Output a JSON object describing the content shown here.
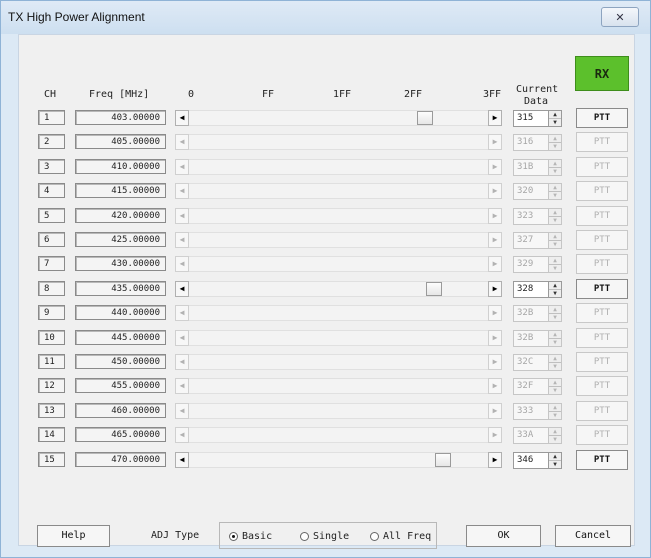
{
  "window": {
    "title": "TX High Power Alignment",
    "close_glyph": "✕"
  },
  "headers": {
    "ch": "CH",
    "freq": "Freq [MHz]",
    "scale": [
      "0",
      "FF",
      "1FF",
      "2FF",
      "3FF"
    ],
    "current_data_line1": "Current",
    "current_data_line2": "Data"
  },
  "rx_button": {
    "label": "RX",
    "color": "#5cc02c"
  },
  "rows": [
    {
      "ch": "1",
      "freq": "403.00000",
      "slider_value": "315",
      "slider_fraction": 0.788,
      "ptt": "PTT",
      "enabled": true
    },
    {
      "ch": "2",
      "freq": "405.00000",
      "slider_value": "316",
      "slider_fraction": 0.771,
      "ptt": "PTT",
      "enabled": false
    },
    {
      "ch": "3",
      "freq": "410.00000",
      "slider_value": "31B",
      "slider_fraction": 0.776,
      "ptt": "PTT",
      "enabled": false
    },
    {
      "ch": "4",
      "freq": "415.00000",
      "slider_value": "320",
      "slider_fraction": 0.781,
      "ptt": "PTT",
      "enabled": false
    },
    {
      "ch": "5",
      "freq": "420.00000",
      "slider_value": "323",
      "slider_fraction": 0.784,
      "ptt": "PTT",
      "enabled": false
    },
    {
      "ch": "6",
      "freq": "425.00000",
      "slider_value": "327",
      "slider_fraction": 0.788,
      "ptt": "PTT",
      "enabled": false
    },
    {
      "ch": "7",
      "freq": "430.00000",
      "slider_value": "329",
      "slider_fraction": 0.79,
      "ptt": "PTT",
      "enabled": false
    },
    {
      "ch": "8",
      "freq": "435.00000",
      "slider_value": "328",
      "slider_fraction": 0.82,
      "ptt": "PTT",
      "enabled": true
    },
    {
      "ch": "9",
      "freq": "440.00000",
      "slider_value": "32B",
      "slider_fraction": 0.793,
      "ptt": "PTT",
      "enabled": false
    },
    {
      "ch": "10",
      "freq": "445.00000",
      "slider_value": "32B",
      "slider_fraction": 0.793,
      "ptt": "PTT",
      "enabled": false
    },
    {
      "ch": "11",
      "freq": "450.00000",
      "slider_value": "32C",
      "slider_fraction": 0.794,
      "ptt": "PTT",
      "enabled": false
    },
    {
      "ch": "12",
      "freq": "455.00000",
      "slider_value": "32F",
      "slider_fraction": 0.797,
      "ptt": "PTT",
      "enabled": false
    },
    {
      "ch": "13",
      "freq": "460.00000",
      "slider_value": "333",
      "slider_fraction": 0.801,
      "ptt": "PTT",
      "enabled": false
    },
    {
      "ch": "14",
      "freq": "465.00000",
      "slider_value": "33A",
      "slider_fraction": 0.808,
      "ptt": "PTT",
      "enabled": false
    },
    {
      "ch": "15",
      "freq": "470.00000",
      "slider_value": "346",
      "slider_fraction": 0.85,
      "ptt": "PTT",
      "enabled": true
    }
  ],
  "footer": {
    "help_label": "Help",
    "adj_type_label": "ADJ Type",
    "adj_options": [
      {
        "label": "Basic",
        "selected": true
      },
      {
        "label": "Single",
        "selected": false
      },
      {
        "label": "All Freq",
        "selected": false
      }
    ],
    "ok_label": "OK",
    "cancel_label": "Cancel"
  }
}
